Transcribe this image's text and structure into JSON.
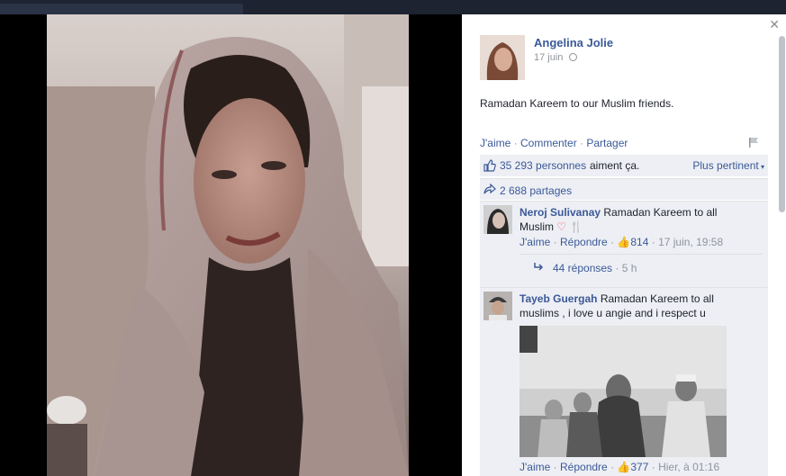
{
  "post": {
    "author": "Angelina Jolie",
    "date": "17 juin",
    "text": "Ramadan Kareem to our Muslim friends.",
    "actions": {
      "like": "J'aime",
      "comment": "Commenter",
      "share": "Partager"
    },
    "likes": {
      "count": "35 293 personnes",
      "suffix": "aiment ça.",
      "sort_label": "Plus pertinent"
    },
    "shares": "2 688 partages"
  },
  "comments": [
    {
      "author": "Neroj Sulivanay",
      "text_line1": "Ramadan Kareem to all",
      "text_line2": "Muslim",
      "like_label": "J'aime",
      "reply_label": "Répondre",
      "likes": "814",
      "time": "17 juin, 19:58",
      "replies": "44 réponses",
      "replies_time": "5 h"
    },
    {
      "author": "Tayeb Guergah",
      "text_line1": "Ramadan Kareem to all",
      "text_line2": "muslims , i love u angie and i respect u",
      "like_label": "J'aime",
      "reply_label": "Répondre",
      "likes": "377",
      "time": "Hier, à 01:16"
    }
  ],
  "icons": {
    "close": "close-icon",
    "globe": "globe-icon",
    "flag": "flag-icon",
    "like": "thumbs-up-icon",
    "share": "share-arrow-icon",
    "reply": "reply-arrow-icon"
  },
  "colors": {
    "link": "#3b5998",
    "meta": "#90949c",
    "panel_bg": "#edeff4"
  }
}
